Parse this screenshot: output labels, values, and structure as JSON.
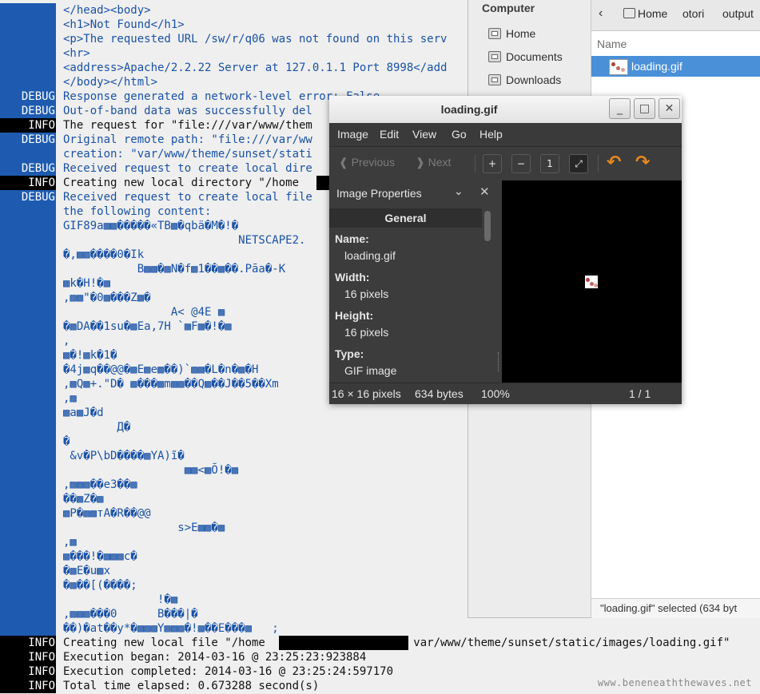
{
  "terminal": {
    "lines": [
      {
        "level": "",
        "text": "</head><body>",
        "color": "blue"
      },
      {
        "level": "",
        "text": "<h1>Not Found</h1>",
        "color": "blue"
      },
      {
        "level": "",
        "text": "<p>The requested URL /sw/r/q06 was not found on this serv",
        "color": "blue"
      },
      {
        "level": "",
        "text": "<hr>",
        "color": "blue"
      },
      {
        "level": "",
        "text": "<address>Apache/2.2.22 Server at 127.0.1.1 Port 8998</add",
        "color": "blue"
      },
      {
        "level": "",
        "text": "</body></html>",
        "color": "blue"
      },
      {
        "level": "DEBUG",
        "text": "Response generated a network-level error: False",
        "color": "blue"
      },
      {
        "level": "DEBUG",
        "text": "Out-of-band data was successfully del",
        "color": "blue"
      },
      {
        "level": "INFO",
        "text": "The request for \"file:///var/www/them",
        "color": "black"
      },
      {
        "level": "DEBUG",
        "text": "Original remote path: \"file:///var/ww",
        "color": "blue"
      },
      {
        "level": "",
        "text": "creation: \"var/www/theme/sunset/stati",
        "color": "blue"
      },
      {
        "level": "DEBUG",
        "text": "Received request to create local dire",
        "color": "blue"
      },
      {
        "level": "INFO",
        "text": "Creating new local directory \"/home",
        "color": "black"
      },
      {
        "level": "DEBUG",
        "text": "Received request to create local file",
        "color": "blue"
      },
      {
        "level": "",
        "text": "the following content:",
        "color": "blue"
      },
      {
        "level": "",
        "text": "GIF89a▩▩�����«TB▩�qbä�M�!�",
        "color": "blue"
      },
      {
        "level": "",
        "text": "                          NETSCAPE2.",
        "color": "blue"
      },
      {
        "level": "",
        "text": "�,▩▩����0�Ik",
        "color": "blue"
      },
      {
        "level": "",
        "text": "           B▩▩�▩N�f▩1��▩��.Pāa�-K",
        "color": "blue"
      },
      {
        "level": "",
        "text": "▩k�H!�▩",
        "color": "blue"
      },
      {
        "level": "",
        "text": ",▩▩\"�0▩���Z▩�",
        "color": "blue"
      },
      {
        "level": "",
        "text": "                A< @4E ▩",
        "color": "blue"
      },
      {
        "level": "",
        "text": "�▩DA��1su�▩Ea,7H `▩F▩�!�▩",
        "color": "blue"
      },
      {
        "level": "",
        "text": ",",
        "color": "blue"
      },
      {
        "level": "",
        "text": "▩�!▩k�1�",
        "color": "blue"
      },
      {
        "level": "",
        "text": "�4j▩q��@@�▩E▩e▩��)`▩▩�L�n�▩�H",
        "color": "blue"
      },
      {
        "level": "",
        "text": ",▩Q▩+.\"D� ▩���▩m▩▩��Q▩��J��5��Xm",
        "color": "blue"
      },
      {
        "level": "",
        "text": ",▩",
        "color": "blue"
      },
      {
        "level": "",
        "text": "▩a▩J�d",
        "color": "blue"
      },
      {
        "level": "",
        "text": "        Д�",
        "color": "blue"
      },
      {
        "level": "",
        "text": "�",
        "color": "blue"
      },
      {
        "level": "",
        "text": " &v�P\\bD����▩YA)ĩ�",
        "color": "blue"
      },
      {
        "level": "",
        "text": "                  ▩▩<▩Õ!�▩",
        "color": "blue"
      },
      {
        "level": "",
        "text": ",▩▩▩��e3��▩",
        "color": "blue"
      },
      {
        "level": "",
        "text": "��▩Z�▩",
        "color": "blue"
      },
      {
        "level": "",
        "text": "▩P�▩▩тA�R��@@",
        "color": "blue"
      },
      {
        "level": "",
        "text": "                 s>E▩▩�▩",
        "color": "blue"
      },
      {
        "level": "",
        "text": ",▩",
        "color": "blue"
      },
      {
        "level": "",
        "text": "▩���!�▩▩▩c�",
        "color": "blue"
      },
      {
        "level": "",
        "text": "�▩E�u▩x",
        "color": "blue"
      },
      {
        "level": "",
        "text": "�▩��[(����;",
        "color": "blue"
      },
      {
        "level": "",
        "text": "              !�▩",
        "color": "blue"
      },
      {
        "level": "",
        "text": ",▩▩▩���0      B���|�",
        "color": "blue"
      },
      {
        "level": "",
        "text": "��)�at��y*�▩▩▩Y▩▩▩�!▩��E���▩   ;",
        "color": "blue"
      },
      {
        "level": "INFO",
        "text": "Creating new local file \"/home                      var/www/theme/sunset/static/images/loading.gif\"",
        "color": "black"
      },
      {
        "level": "INFO",
        "text": "Execution began: 2014-03-16 @ 23:25:23:923884",
        "color": "black"
      },
      {
        "level": "INFO",
        "text": "Execution completed: 2014-03-16 @ 23:25:24:597170",
        "color": "black"
      },
      {
        "level": "INFO",
        "text": "Total time elapsed: 0.673288 second(s)",
        "color": "black"
      }
    ],
    "watermark": "www.beneneaththewaves.net"
  },
  "file_manager": {
    "sidebar_section": "Computer",
    "places": [
      {
        "label": "Home",
        "icon": "home-folder-icon"
      },
      {
        "label": "Documents",
        "icon": "documents-folder-icon"
      },
      {
        "label": "Downloads",
        "icon": "downloads-folder-icon"
      }
    ],
    "back_glyph": "‹",
    "breadcrumbs": [
      "Home",
      "otori",
      "output"
    ],
    "column_header": "Name",
    "file_name": "loading.gif",
    "status": "\"loading.gif\" selected (634 byt"
  },
  "viewer": {
    "title": "loading.gif",
    "window_buttons": {
      "minimize": "_",
      "maximize": "□",
      "close": "✕"
    },
    "menu": [
      "Image",
      "Edit",
      "View",
      "Go",
      "Help"
    ],
    "toolbar": {
      "previous": "Previous",
      "next": "Next"
    },
    "panel_title": "Image Properties",
    "section": "General",
    "properties": [
      {
        "label": "Name:",
        "value": "loading.gif"
      },
      {
        "label": "Width:",
        "value": "16 pixels"
      },
      {
        "label": "Height:",
        "value": "16 pixels"
      },
      {
        "label": "Type:",
        "value": "GIF image"
      }
    ],
    "status": {
      "dimensions": "16 × 16 pixels",
      "size": "634 bytes",
      "zoom": "100%",
      "position": "1 / 1"
    }
  }
}
